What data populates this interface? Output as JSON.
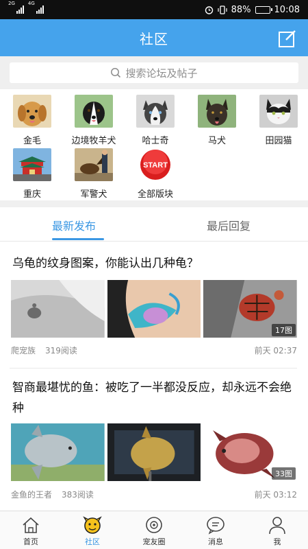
{
  "status_bar": {
    "network1": "2G",
    "network2": "4G",
    "battery": "88%",
    "battery_level": 0.88,
    "time": "10:08"
  },
  "header": {
    "title": "社区"
  },
  "search": {
    "placeholder": "搜索论坛及帖子"
  },
  "forums": [
    {
      "label": "金毛",
      "icon": "golden-retriever"
    },
    {
      "label": "边境牧羊犬",
      "icon": "border-collie"
    },
    {
      "label": "哈士奇",
      "icon": "husky"
    },
    {
      "label": "马犬",
      "icon": "malinois"
    },
    {
      "label": "田园猫",
      "icon": "cat"
    },
    {
      "label": "重庆",
      "icon": "chongqing"
    },
    {
      "label": "军警犬",
      "icon": "police-dog"
    },
    {
      "label": "全部版块",
      "icon": "start-button",
      "badge": "START"
    }
  ],
  "tabs": {
    "latest": "最新发布",
    "last_reply": "最后回复"
  },
  "posts": [
    {
      "title": "乌龟的纹身图案，你能认出几种龟？",
      "author": "爬宠族",
      "views": "319阅读",
      "time": "前天 02:37",
      "image_count": "17图"
    },
    {
      "title": "智商最堪忧的鱼：被吃了一半都没反应，却永远不会绝种",
      "author": "金鱼的王者",
      "views": "383阅读",
      "time": "前天 03:12",
      "image_count": "33图"
    }
  ],
  "bottom_nav": [
    {
      "label": "首页",
      "icon": "home-icon"
    },
    {
      "label": "社区",
      "icon": "community-icon"
    },
    {
      "label": "宠友圈",
      "icon": "pet-circle-icon"
    },
    {
      "label": "消息",
      "icon": "message-icon"
    },
    {
      "label": "我",
      "icon": "profile-icon"
    }
  ],
  "colors": {
    "accent": "#45a3ec",
    "tab_active": "#3a97e3"
  }
}
